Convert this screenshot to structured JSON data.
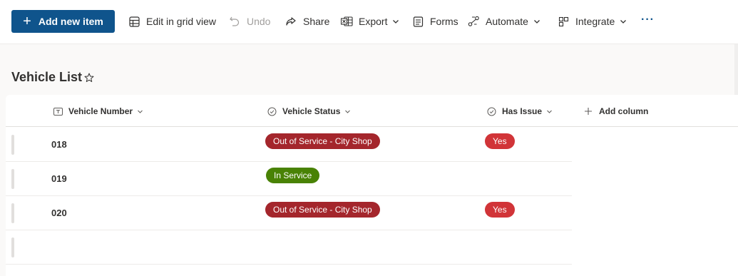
{
  "toolbar": {
    "add_label": "Add new item",
    "items": [
      {
        "label": "Edit in grid view",
        "icon": "grid-icon"
      },
      {
        "label": "Undo",
        "icon": "undo-icon",
        "disabled": true
      },
      {
        "label": "Share",
        "icon": "share-icon"
      },
      {
        "label": "Export",
        "icon": "excel-icon",
        "dropdown": true
      },
      {
        "label": "Forms",
        "icon": "form-icon"
      },
      {
        "label": "Automate",
        "icon": "flow-icon",
        "dropdown": true
      },
      {
        "label": "Integrate",
        "icon": "integrate-icon",
        "dropdown": true
      }
    ],
    "more_label": "···"
  },
  "list": {
    "title": "Vehicle List"
  },
  "columns": [
    {
      "label": "Vehicle Number"
    },
    {
      "label": "Vehicle Status"
    },
    {
      "label": "Has Issue"
    },
    {
      "label": "Add column"
    }
  ],
  "rows": [
    {
      "number": "018",
      "status": "Out of Service - City Shop",
      "status_type": "out",
      "issue": "Yes"
    },
    {
      "number": "019",
      "status": "In Service",
      "status_type": "in",
      "issue": ""
    },
    {
      "number": "020",
      "status": "Out of Service - City Shop",
      "status_type": "out",
      "issue": "Yes"
    },
    {
      "number": "",
      "status": "",
      "status_type": "",
      "issue": ""
    }
  ],
  "colors": {
    "primary": "#0f548c",
    "out_of_service": "#a4262c",
    "in_service": "#498205",
    "yes": "#d13438"
  }
}
